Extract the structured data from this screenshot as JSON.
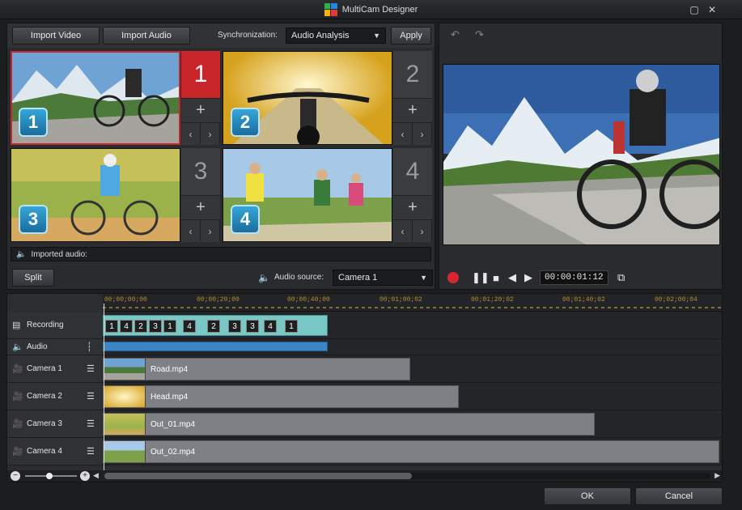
{
  "window": {
    "title": "MultiCam Designer"
  },
  "toolbar": {
    "import_video": "Import Video",
    "import_audio": "Import Audio",
    "sync_label": "Synchronization:",
    "sync_value": "Audio Analysis",
    "apply": "Apply"
  },
  "cameras": [
    {
      "num": "1",
      "badge": "1",
      "active": true
    },
    {
      "num": "2",
      "badge": "2",
      "active": false
    },
    {
      "num": "3",
      "badge": "3",
      "active": false
    },
    {
      "num": "4",
      "badge": "4",
      "active": false
    }
  ],
  "imported_audio_label": "Imported audio:",
  "split_label": "Split",
  "audio_source": {
    "label": "Audio source:",
    "value": "Camera 1"
  },
  "preview": {
    "timecode": "00:00:01:12"
  },
  "ruler_ticks": [
    "00;00;00;00",
    "00;00;20;00",
    "00;00;40;00",
    "00;01;00;02",
    "00;01;20;02",
    "00;01;40;02",
    "00;02;00;04"
  ],
  "tracks": {
    "recording": "Recording",
    "audio": "Audio",
    "cam1": "Camera 1",
    "cam2": "Camera 2",
    "cam3": "Camera 3",
    "cam4": "Camera 4"
  },
  "recording_segments": [
    "1",
    "4",
    "2",
    "3",
    "1",
    "4",
    "2",
    "3",
    "3",
    "4",
    "1"
  ],
  "clips": {
    "cam1": "Road.mp4",
    "cam2": "Head.mp4",
    "cam3": "Out_01.mp4",
    "cam4": "Out_02.mp4"
  },
  "footer": {
    "ok": "OK",
    "cancel": "Cancel"
  },
  "colors": {
    "active_red": "#c9262b",
    "badge_blue": "#2a8cc4",
    "recording_teal": "#78c8c6",
    "audio_blue": "#3d86c6"
  }
}
